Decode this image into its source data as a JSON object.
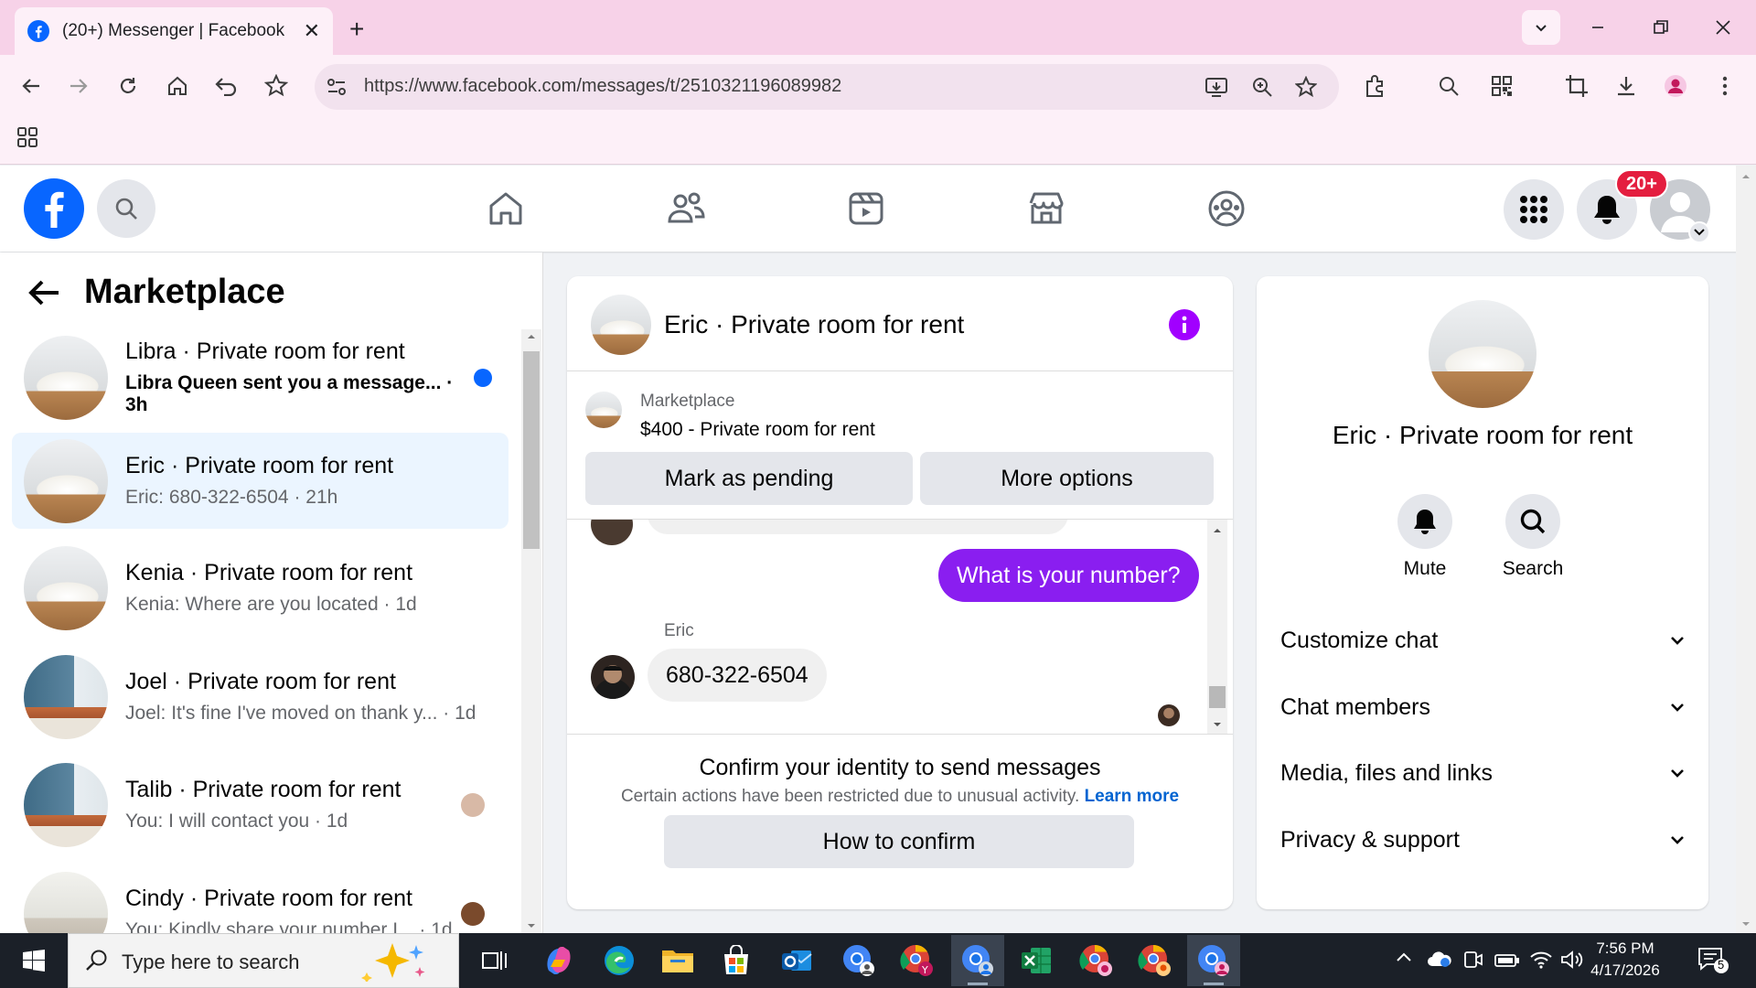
{
  "browser": {
    "tab_title": "(20+) Messenger | Facebook",
    "new_tab": "+",
    "url": "https://www.facebook.com/messages/t/2510321196089982"
  },
  "fbnav": {
    "notification_count": "20+"
  },
  "left_panel": {
    "title": "Marketplace",
    "conversations": [
      {
        "name": "Libra · Private room for rent",
        "preview": "Libra Queen sent you a message... · 3h",
        "unread": true
      },
      {
        "name": "Eric · Private room for rent",
        "preview": "Eric: 680-322-6504 · 21h",
        "selected": true
      },
      {
        "name": "Kenia · Private room for rent",
        "preview": "Kenia: Where are you located · 1d"
      },
      {
        "name": "Joel · Private room for rent",
        "preview": "Joel: It's fine I've moved on thank y... · 1d"
      },
      {
        "name": "Talib · Private room for rent",
        "preview": "You: I will contact you · 1d"
      },
      {
        "name": "Cindy · Private room for rent",
        "preview": "You: Kindly share your number I... · 1d"
      }
    ]
  },
  "chat": {
    "header_name": "Eric · Private room for rent",
    "listing_label": "Marketplace",
    "listing_price": "$400 - Private room for rent",
    "mark_pending": "Mark as pending",
    "more_options": "More options",
    "outgoing_message": "What is your number?",
    "sender_name": "Eric",
    "incoming_message": "680-322-6504",
    "confirm_title": "Confirm your identity to send messages",
    "confirm_text": "Certain actions have been restricted due to unusual activity.",
    "learn_more": "Learn more",
    "how_to_confirm": "How to confirm"
  },
  "right_panel": {
    "name": "Eric · Private room for rent",
    "mute": "Mute",
    "search": "Search",
    "sections": [
      "Customize chat",
      "Chat members",
      "Media, files and links",
      "Privacy & support"
    ]
  },
  "taskbar": {
    "search_placeholder": "Type here to search",
    "time": "7:56 PM",
    "date": "4/17/2026",
    "notifications": "5"
  },
  "colors": {
    "accent": "#0866ff",
    "message_purple": "#8a1ef0",
    "info_purple": "#a100ff",
    "selected_row": "#ebf5ff",
    "badge_red": "#e41e3f",
    "tabbar_pink": "#f7d2e8"
  }
}
